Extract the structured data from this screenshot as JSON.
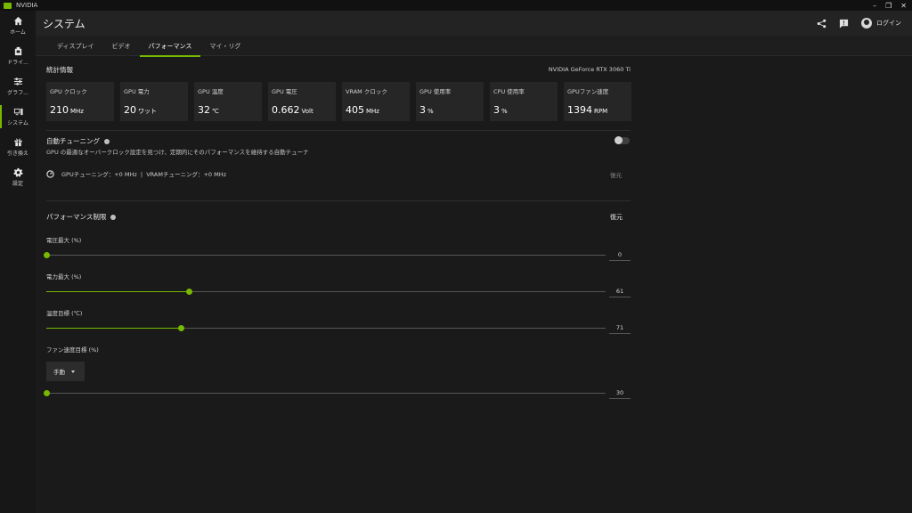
{
  "app": {
    "title": "NVIDIA",
    "accent": "#76b900"
  },
  "window_controls": [
    "–",
    "❐",
    "✕"
  ],
  "sidebar": {
    "items": [
      {
        "label": "ホーム",
        "icon": "home-icon"
      },
      {
        "label": "ドライ...",
        "icon": "driver-icon"
      },
      {
        "label": "グラフ...",
        "icon": "graphics-icon"
      },
      {
        "label": "システム",
        "icon": "system-icon",
        "active": true
      },
      {
        "label": "引き換え",
        "icon": "gift-icon"
      },
      {
        "label": "設定",
        "icon": "gear-icon"
      }
    ]
  },
  "header": {
    "title": "システム",
    "login_label": "ログイン"
  },
  "tabs": [
    {
      "label": "ディスプレイ"
    },
    {
      "label": "ビデオ"
    },
    {
      "label": "パフォーマンス",
      "active": true
    },
    {
      "label": "マイ・リグ"
    }
  ],
  "stats": {
    "title": "統計情報",
    "gpu_name": "NVIDIA GeForce RTX 3060 Ti",
    "items": [
      {
        "label": "GPU クロック",
        "value": "210",
        "unit": "MHz"
      },
      {
        "label": "GPU 電力",
        "value": "20",
        "unit": "ワット"
      },
      {
        "label": "GPU 温度",
        "value": "32",
        "unit": "℃"
      },
      {
        "label": "GPU 電圧",
        "value": "0.662",
        "unit": "Volt"
      },
      {
        "label": "VRAM クロック",
        "value": "405",
        "unit": "MHz"
      },
      {
        "label": "GPU 使用率",
        "value": "3",
        "unit": "%"
      },
      {
        "label": "CPU 使用率",
        "value": "3",
        "unit": "%"
      },
      {
        "label": "GPUファン速度",
        "value": "1394",
        "unit": "RPM"
      }
    ]
  },
  "auto_tuning": {
    "title": "自動チューニング",
    "description": "GPU の最適なオーバークロック設定を見つけ、定期的にそのパフォーマンスを維持する自動チューナ",
    "enabled": false,
    "status": "GPUチューニング：+0 MHz  |  VRAMチューニング：+0 MHz",
    "restore_label": "復元"
  },
  "perf_limits": {
    "title": "パフォーマンス制限",
    "restore_label": "復元",
    "sliders": [
      {
        "label": "電圧最大 (%)",
        "value": "0",
        "fraction": 0.0
      },
      {
        "label": "電力最大 (%)",
        "value": "61",
        "fraction": 0.255
      },
      {
        "label": "温度目標 (℃)",
        "value": "71",
        "fraction": 0.241
      },
      {
        "label": "ファン速度目標 (%)",
        "value": "30",
        "fraction": 0.0
      }
    ],
    "fan_mode": "手動"
  }
}
